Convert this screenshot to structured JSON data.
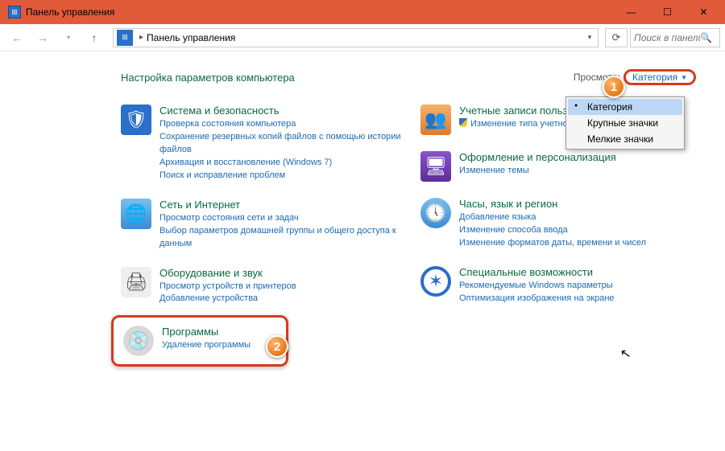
{
  "titlebar": {
    "title": "Панель управления"
  },
  "navbar": {
    "breadcrumb": "Панель управления",
    "searchPlaceholder": "Поиск в панели..."
  },
  "heading": "Настройка параметров компьютера",
  "viewBy": {
    "label": "Просмотр:",
    "value": "Категория"
  },
  "dropdown": {
    "opt1": "Категория",
    "opt2": "Крупные значки",
    "opt3": "Мелкие значки"
  },
  "left": {
    "c1": {
      "title": "Система и безопасность",
      "l1": "Проверка состояния компьютера",
      "l2": "Сохранение резервных копий файлов с помощью истории файлов",
      "l3": "Архивация и восстановление (Windows 7)",
      "l4": "Поиск и исправление проблем"
    },
    "c2": {
      "title": "Сеть и Интернет",
      "l1": "Просмотр состояния сети и задач",
      "l2": "Выбор параметров домашней группы и общего доступа к данным"
    },
    "c3": {
      "title": "Оборудование и звук",
      "l1": "Просмотр устройств и принтеров",
      "l2": "Добавление устройства"
    },
    "c4": {
      "title": "Программы",
      "l1": "Удаление программы"
    }
  },
  "right": {
    "c1": {
      "title": "Учетные записи пользовате",
      "l1": "Изменение типа учетной записи"
    },
    "c2": {
      "title": "Оформление и персонализация",
      "l1": "Изменение темы"
    },
    "c3": {
      "title": "Часы, язык и регион",
      "l1": "Добавление языка",
      "l2": "Изменение способа ввода",
      "l3": "Изменение форматов даты, времени и чисел"
    },
    "c4": {
      "title": "Специальные возможности",
      "l1": "Рекомендуемые Windows параметры",
      "l2": "Оптимизация изображения на экране"
    }
  },
  "badges": {
    "b1": "1",
    "b2": "2"
  }
}
